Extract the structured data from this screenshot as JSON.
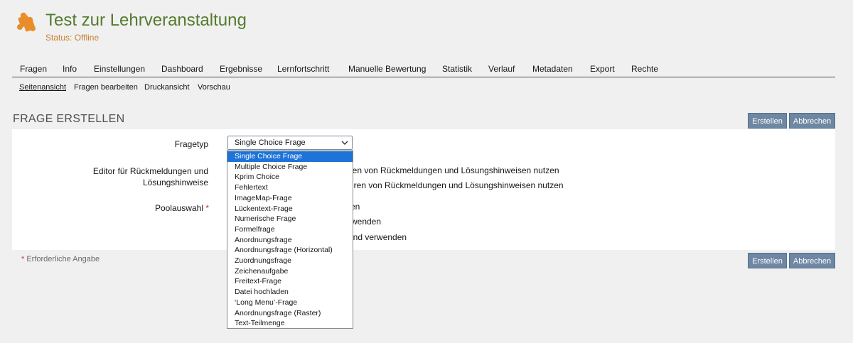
{
  "header": {
    "title": "Test zur Lehrveranstaltung",
    "status": "Status: Offline",
    "icon": "puzzle-icon",
    "icon_color": "#e88d2a",
    "title_color": "#557b2e"
  },
  "tabs": [
    "Fragen",
    "Info",
    "Einstellungen",
    "Dashboard",
    "Ergebnisse",
    "Lernfortschritt",
    "Manuelle Bewertung",
    "Statistik",
    "Verlauf",
    "Metadaten",
    "Export",
    "Rechte"
  ],
  "subtabs": {
    "items": [
      "Seitenansicht",
      "Fragen bearbeiten",
      "Druckansicht",
      "Vorschau"
    ],
    "active": "Seitenansicht"
  },
  "form": {
    "section_title": "FRAGE ERSTELLEN",
    "create_label": "Erstellen",
    "cancel_label": "Abbrechen",
    "fragetyp_label": "Fragetyp",
    "editor_label_line1": "Editor für Rückmeldungen und",
    "editor_label_line2": "Lösungshinweise",
    "editor_option1_visible": "eren von Rückmeldungen und Lösungshinweisen nutzen",
    "editor_option2_visible": "tieren von Rückmeldungen und Lösungshinweisen nutzen",
    "pool_label": "Poolauswahl",
    "required_marker": "*",
    "pool_option1_visible": "en",
    "pool_option2_visible": "rwenden",
    "pool_option3_visible": "und verwenden",
    "required_note": "Erforderliche Angabe",
    "button_color": "#6e87a3"
  },
  "select": {
    "value": "Single Choice Frage",
    "options": [
      "Single Choice Frage",
      "Multiple Choice Frage",
      "Kprim Choice",
      "Fehlertext",
      "ImageMap-Frage",
      "Lückentext-Frage",
      "Numerische Frage",
      "Formelfrage",
      "Anordnungsfrage",
      "Anordnungsfrage (Horizontal)",
      "Zuordnungsfrage",
      "Zeichenaufgabe",
      "Freitext-Frage",
      "Datei hochladen",
      "‘Long Menu’-Frage",
      "Anordnungsfrage (Raster)",
      "Text-Teilmenge"
    ],
    "selected_index": 0,
    "highlight_color": "#1e73d8"
  }
}
